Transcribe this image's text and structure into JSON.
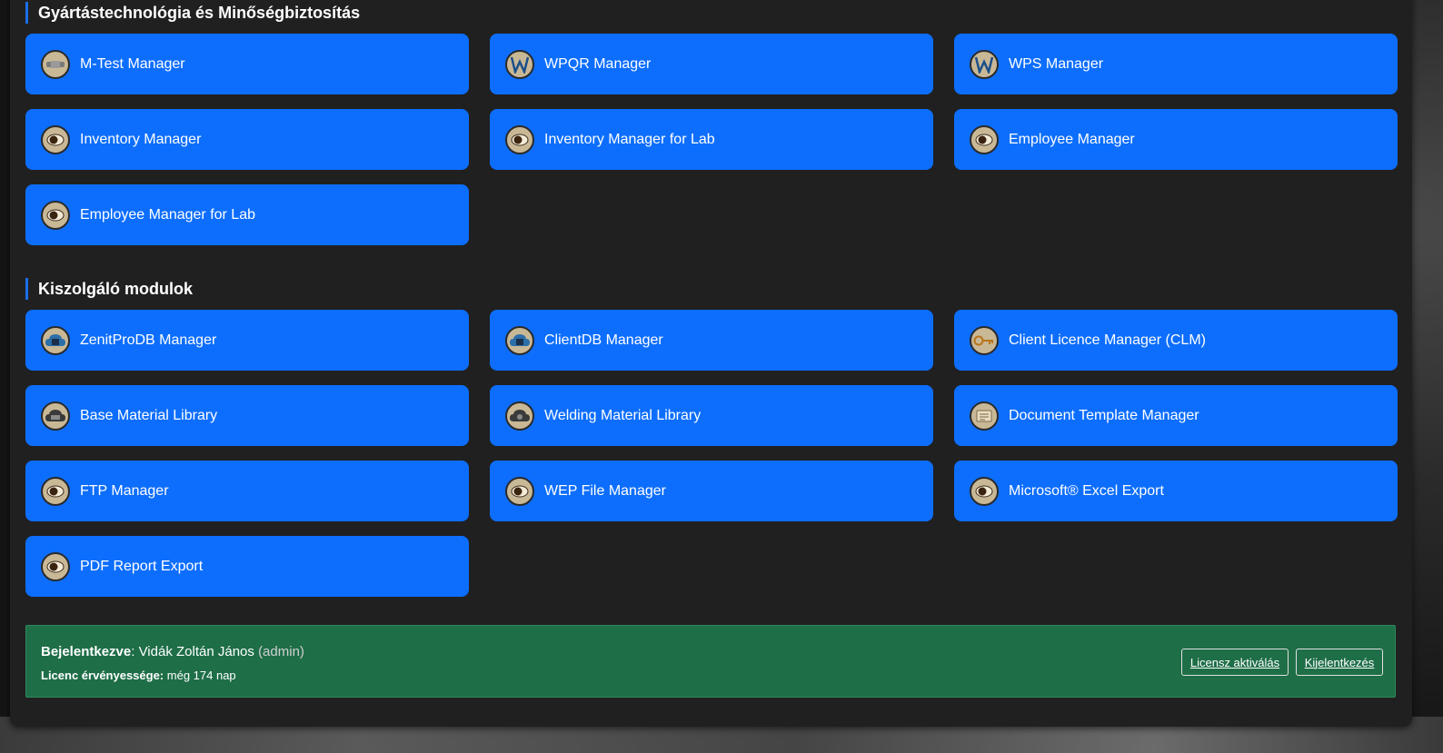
{
  "sections": [
    {
      "title": "Gyártástechnológia és Minőségbiztosítás",
      "tiles": [
        {
          "label": "M-Test Manager",
          "icon": "mtest-icon"
        },
        {
          "label": "WPQR Manager",
          "icon": "wpqr-icon"
        },
        {
          "label": "WPS Manager",
          "icon": "wps-icon"
        },
        {
          "label": "Inventory Manager",
          "icon": "module-icon"
        },
        {
          "label": "Inventory Manager for Lab",
          "icon": "module-icon"
        },
        {
          "label": "Employee Manager",
          "icon": "module-icon"
        },
        {
          "label": "Employee Manager for Lab",
          "icon": "module-icon"
        }
      ]
    },
    {
      "title": "Kiszolgáló modulok",
      "tiles": [
        {
          "label": "ZenitProDB Manager",
          "icon": "database-cloud-icon"
        },
        {
          "label": "ClientDB Manager",
          "icon": "database-cloud-icon"
        },
        {
          "label": "Client Licence Manager (CLM)",
          "icon": "key-icon"
        },
        {
          "label": "Base Material Library",
          "icon": "material-cloud-icon"
        },
        {
          "label": "Welding Material Library",
          "icon": "material-cloud-icon"
        },
        {
          "label": "Document Template Manager",
          "icon": "document-template-icon"
        },
        {
          "label": "FTP Manager",
          "icon": "module-icon"
        },
        {
          "label": "WEP File Manager",
          "icon": "module-icon"
        },
        {
          "label": "Microsoft® Excel Export",
          "icon": "module-icon"
        },
        {
          "label": "PDF Report Export",
          "icon": "module-icon"
        }
      ]
    }
  ],
  "footer": {
    "logged_in_label": "Bejelentkezve",
    "user_name": "Vidák Zoltán János",
    "user_role": "(admin)",
    "licence_label": "Licenc érvényessége:",
    "licence_value": "még 174 nap",
    "activate_button": "Licensz aktiválás",
    "logout_button": "Kijelentkezés"
  },
  "colors": {
    "tile": "#0d6efd",
    "panel": "#202021",
    "footer": "#1e6e47",
    "section_accent": "#1a6ee6"
  }
}
